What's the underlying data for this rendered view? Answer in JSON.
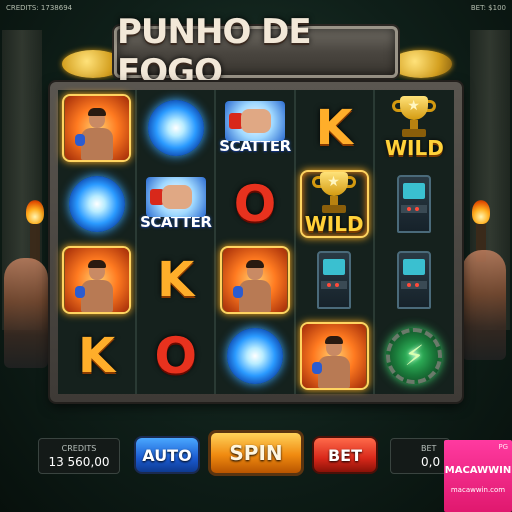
{
  "top_bar": {
    "credits_text": "CREDITS: 1738694",
    "bet_text": "BET: $100"
  },
  "title": "PUNHO DE FOGO",
  "reels": [
    [
      {
        "type": "fighter",
        "highlight": true
      },
      {
        "type": "orb",
        "highlight": false
      },
      {
        "type": "scatter",
        "label": "SCATTER",
        "highlight": false
      },
      {
        "type": "letter",
        "label": "K",
        "color": "orange",
        "highlight": false
      },
      {
        "type": "wild",
        "label": "WILD",
        "highlight": false
      }
    ],
    [
      {
        "type": "orb",
        "highlight": false
      },
      {
        "type": "scatter",
        "label": "SCATTER",
        "highlight": false
      },
      {
        "type": "letter",
        "label": "O",
        "color": "red",
        "highlight": false
      },
      {
        "type": "wild",
        "label": "WILD",
        "highlight": true
      },
      {
        "type": "arcade",
        "highlight": false
      }
    ],
    [
      {
        "type": "fighter",
        "highlight": true
      },
      {
        "type": "letter",
        "label": "K",
        "color": "orange",
        "highlight": false
      },
      {
        "type": "fighter",
        "highlight": true
      },
      {
        "type": "arcade",
        "highlight": false
      },
      {
        "type": "arcade",
        "highlight": false
      }
    ],
    [
      {
        "type": "letter",
        "label": "K",
        "color": "orange",
        "highlight": false
      },
      {
        "type": "letter",
        "label": "O",
        "color": "red",
        "highlight": false
      },
      {
        "type": "orb",
        "highlight": false
      },
      {
        "type": "fighter",
        "highlight": true
      },
      {
        "type": "bolt",
        "highlight": false
      }
    ]
  ],
  "controls": {
    "credits_label": "CREDITS",
    "credits_value": "13 560,00",
    "auto_label": "AUTO",
    "spin_label": "SPIN",
    "bet_button_label": "BET",
    "bet_label": "BET",
    "bet_value": "0,0"
  },
  "promo": {
    "top_text": "PG",
    "brand": "MACAWWIN",
    "url": "macawwin.com"
  },
  "colors": {
    "orange_letter": "#ffae2a",
    "red_letter": "#e8321e",
    "wild_gold": "#ffd23a",
    "highlight_border": "#ffd460",
    "spin_button": "#f08a10",
    "auto_button": "#1a5ad0",
    "bet_button": "#d8281a",
    "promo_pink": "#e0186e"
  }
}
